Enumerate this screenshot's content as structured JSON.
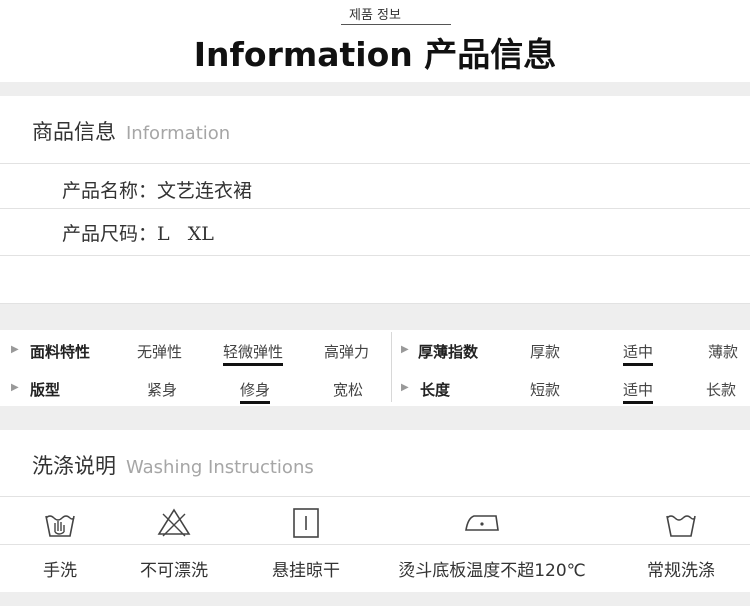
{
  "header": {
    "small_label": "제품 정보",
    "title": "Information 产品信息"
  },
  "product_info": {
    "title": "商品信息",
    "subtitle": "Information",
    "lines": [
      "产品名称：文艺连衣裙",
      "产品尺码：L   XL"
    ]
  },
  "attributes": {
    "left": [
      {
        "label": "面料特性",
        "options": [
          "无弹性",
          "轻微弹性",
          "高弹力"
        ],
        "selected": 1
      },
      {
        "label": "版型",
        "options": [
          "紧身",
          "修身",
          "宽松"
        ],
        "selected": 1
      }
    ],
    "right": [
      {
        "label": "厚薄指数",
        "options": [
          "厚款",
          "适中",
          "薄款"
        ],
        "selected": 1
      },
      {
        "label": "长度",
        "options": [
          "短款",
          "适中",
          "长款"
        ],
        "selected": 1
      }
    ]
  },
  "washing": {
    "title": "洗涤说明",
    "subtitle": "Washing Instructions",
    "items": [
      {
        "icon": "hand-wash-icon",
        "label": "手洗"
      },
      {
        "icon": "no-bleach-icon",
        "label": "不可漂洗"
      },
      {
        "icon": "hang-dry-icon",
        "label": "悬挂晾干"
      },
      {
        "icon": "iron-icon",
        "label": "烫斗底板温度不超120℃"
      },
      {
        "icon": "normal-wash-icon",
        "label": "常规洗涤"
      }
    ]
  }
}
